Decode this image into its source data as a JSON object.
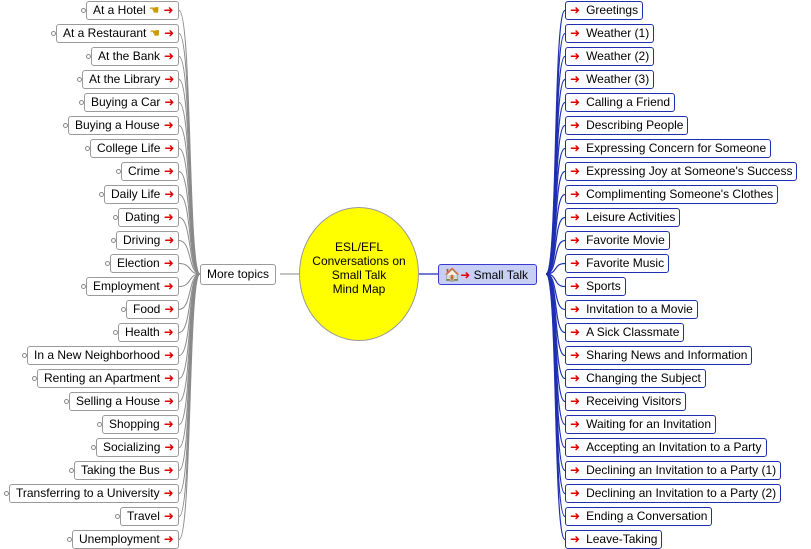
{
  "center": {
    "title": "ESL/EFL\nConversations on\nSmall Talk\nMind Map",
    "color": "#ffff00"
  },
  "left_branch": {
    "label": "More topics"
  },
  "right_branch": {
    "label": "Small Talk",
    "icon": "house-icon"
  },
  "left_topics": [
    {
      "label": "At a Hotel",
      "icon": "hand-pointing-icon"
    },
    {
      "label": "At a Restaurant",
      "icon": "hand-pointing-icon"
    },
    {
      "label": "At the Bank"
    },
    {
      "label": "At the Library"
    },
    {
      "label": "Buying a Car"
    },
    {
      "label": "Buying a House"
    },
    {
      "label": "College Life"
    },
    {
      "label": "Crime"
    },
    {
      "label": "Daily Life"
    },
    {
      "label": "Dating"
    },
    {
      "label": "Driving"
    },
    {
      "label": "Election"
    },
    {
      "label": "Employment"
    },
    {
      "label": "Food"
    },
    {
      "label": "Health"
    },
    {
      "label": "In a New Neighborhood"
    },
    {
      "label": "Renting an Apartment"
    },
    {
      "label": "Selling a House"
    },
    {
      "label": "Shopping"
    },
    {
      "label": "Socializing"
    },
    {
      "label": "Taking the Bus"
    },
    {
      "label": "Transferring to a University"
    },
    {
      "label": "Travel"
    },
    {
      "label": "Unemployment"
    }
  ],
  "right_topics": [
    "Greetings",
    "Weather (1)",
    "Weather (2)",
    "Weather (3)",
    "Calling a Friend",
    "Describing People",
    "Expressing Concern for Someone",
    "Expressing Joy at Someone's Success",
    "Complimenting Someone's Clothes",
    "Leisure Activities",
    "Favorite Movie",
    "Favorite Music",
    "Sports",
    "Invitation to a Movie",
    "A Sick Classmate",
    "Sharing News and Information",
    "Changing the Subject",
    "Receiving Visitors",
    "Waiting for an Invitation",
    "Accepting an Invitation to a Party",
    "Declining an Invitation to a Party (1)",
    "Declining an Invitation to a Party (2)",
    "Ending a Conversation",
    "Leave-Taking"
  ],
  "colors": {
    "left_line": "#8a8a8a",
    "right_line": "#1f2fb0",
    "arrow": "#e00000",
    "small_talk_bg": "#c8cff5"
  }
}
